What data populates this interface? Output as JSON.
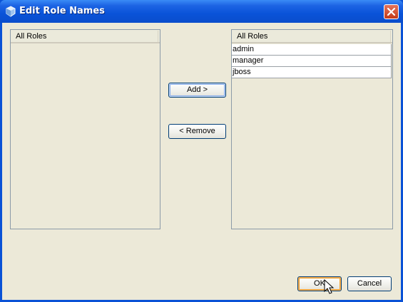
{
  "window": {
    "title": "Edit Role Names",
    "icons": {
      "app": "java-cup-icon",
      "close": "close-icon"
    }
  },
  "left_list": {
    "header": "All Roles",
    "items": []
  },
  "right_list": {
    "header": "All Roles",
    "items": [
      {
        "label": "admin"
      },
      {
        "label": "manager"
      },
      {
        "label": "jboss"
      }
    ]
  },
  "buttons": {
    "add": "Add >",
    "remove": "< Remove",
    "ok": "OK",
    "cancel": "Cancel"
  },
  "colors": {
    "titlebar": "#0a53d8",
    "dialog_background": "#ece9d8",
    "close_button": "#c33a18",
    "default_button_highlight": "#f0a030"
  }
}
